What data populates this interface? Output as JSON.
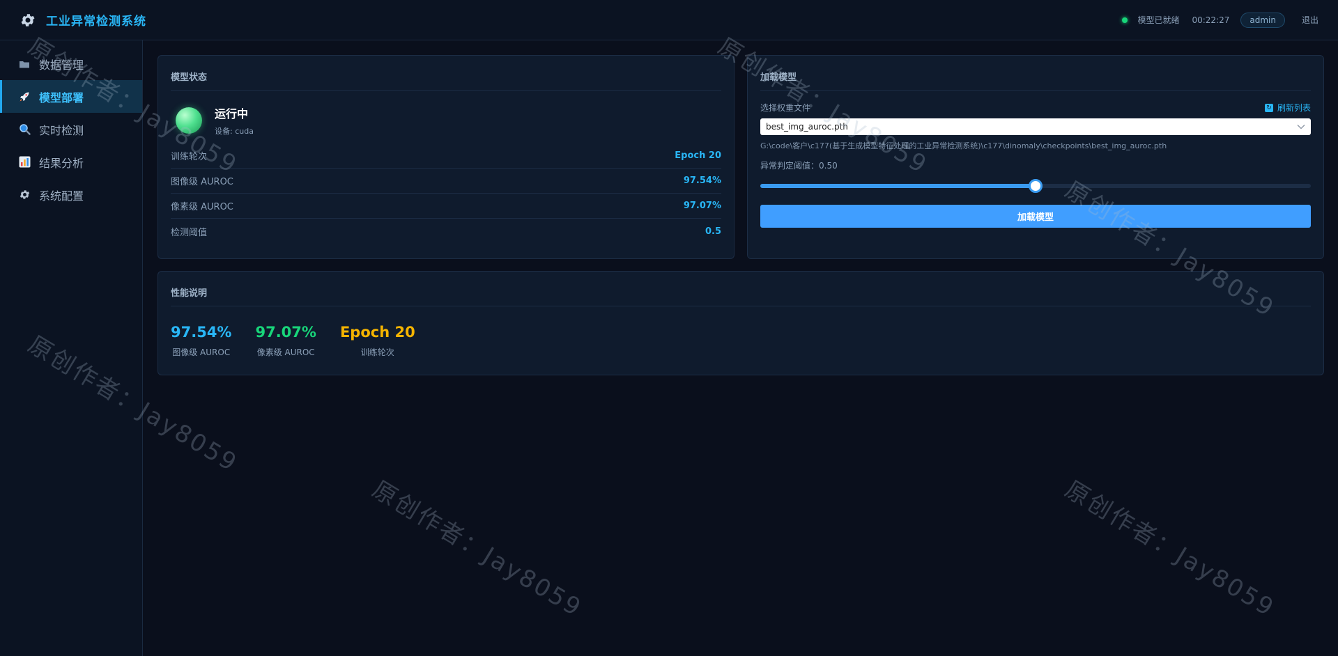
{
  "header": {
    "title": "工业异常检测系统",
    "status_text": "模型已就绪",
    "time": "00:22:27",
    "user": "admin",
    "logout_label": "退出",
    "status_color": "#18d67a"
  },
  "sidebar": {
    "items": [
      {
        "label": "数据管理",
        "icon": "folder-icon"
      },
      {
        "label": "模型部署",
        "icon": "rocket-icon",
        "active": true
      },
      {
        "label": "实时检测",
        "icon": "magnifier-icon"
      },
      {
        "label": "结果分析",
        "icon": "bar-chart-icon"
      },
      {
        "label": "系统配置",
        "icon": "gear-icon"
      }
    ]
  },
  "model_status": {
    "title": "模型状态",
    "state": "运行中",
    "device": "设备: cuda",
    "metrics": [
      {
        "label": "训练轮次",
        "value": "Epoch 20"
      },
      {
        "label": "图像级 AUROC",
        "value": "97.54%"
      },
      {
        "label": "像素级 AUROC",
        "value": "97.07%"
      },
      {
        "label": "检测阈值",
        "value": "0.5"
      }
    ]
  },
  "load_model": {
    "title": "加载模型",
    "select_label": "选择权重文件",
    "refresh_label": "刷新列表",
    "selected_file": "best_img_auroc.pth",
    "path": "G:\\code\\客户\\c177(基于生成模型特征处理的工业异常检测系统)\\c177\\dinomaly\\checkpoints\\best_img_auroc.pth",
    "threshold_label": "异常判定阈值：0.50",
    "threshold_value": 0.5,
    "button_label": "加载模型"
  },
  "performance": {
    "title": "性能说明",
    "stats": [
      {
        "value": "97.54%",
        "label": "图像级 AUROC",
        "color": "#29b6f6"
      },
      {
        "value": "97.07%",
        "label": "像素级 AUROC",
        "color": "#18d67a"
      },
      {
        "value": "Epoch 20",
        "label": "训练轮次",
        "color": "#f5b400"
      }
    ]
  },
  "watermark": "原创作者：Jay8059"
}
